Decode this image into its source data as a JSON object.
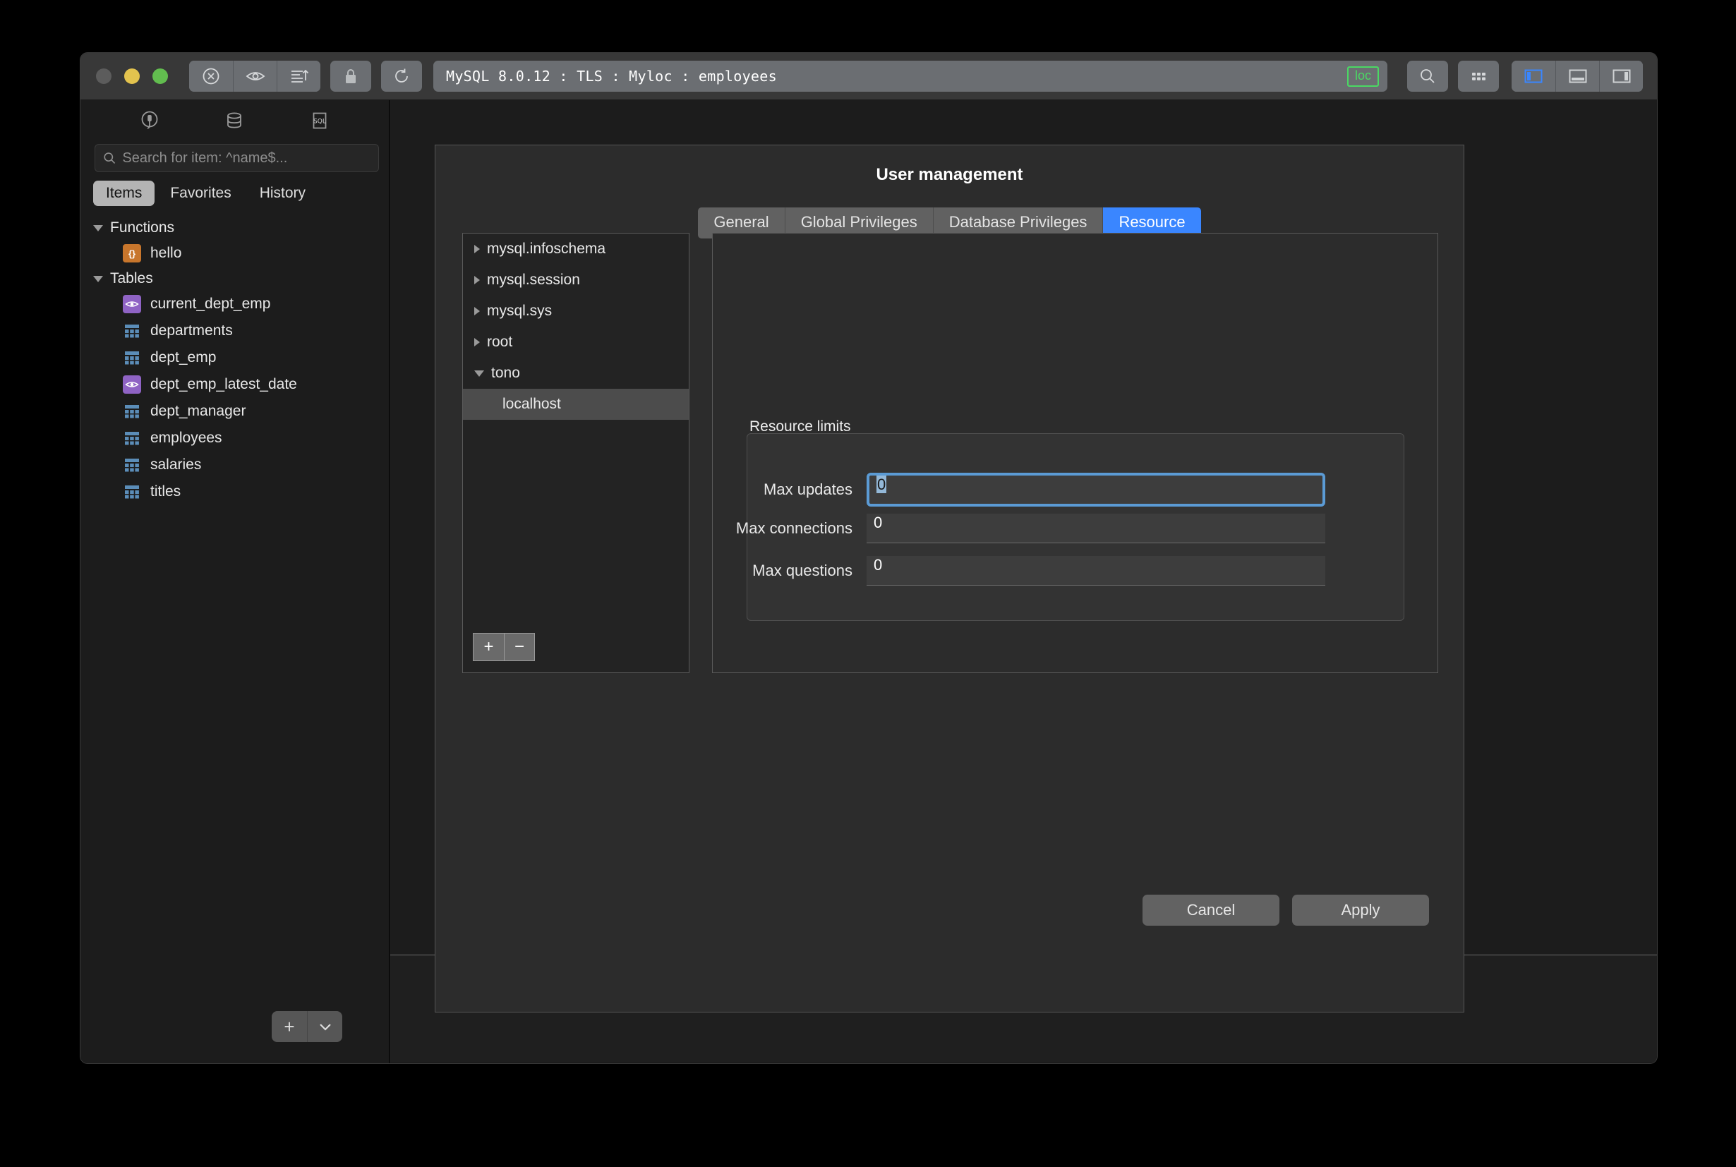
{
  "window": {
    "title": "MySQL 8.0.12 : TLS : Myloc : employees",
    "loc_badge": "loc",
    "accent_blue": "#3a86ff",
    "badge_green": "#4ad964"
  },
  "toolbar": {
    "stop_label": "stop-button",
    "preview_label": "preview-button",
    "export_label": "export-button",
    "lock_label": "lock-button",
    "refresh_label": "refresh-button",
    "search_label": "search-button",
    "grid_label": "grid-button",
    "panel_left_label": "left-panel-toggle",
    "panel_bottom_label": "bottom-panel-toggle",
    "panel_right_label": "right-panel-toggle"
  },
  "sidebar": {
    "icons": [
      "connection-icon",
      "database-icon",
      "sql-icon"
    ],
    "search": {
      "placeholder": "Search for item: ^name$...",
      "value": ""
    },
    "tabs": [
      {
        "label": "Items",
        "active": true
      },
      {
        "label": "Favorites",
        "active": false
      },
      {
        "label": "History",
        "active": false
      }
    ],
    "groups": [
      {
        "label": "Functions",
        "expanded": true,
        "items": [
          {
            "label": "hello",
            "icon": "function-icon"
          }
        ]
      },
      {
        "label": "Tables",
        "expanded": true,
        "items": [
          {
            "label": "current_dept_emp",
            "icon": "view-icon"
          },
          {
            "label": "departments",
            "icon": "table-icon"
          },
          {
            "label": "dept_emp",
            "icon": "table-icon"
          },
          {
            "label": "dept_emp_latest_date",
            "icon": "view-icon"
          },
          {
            "label": "dept_manager",
            "icon": "table-icon"
          },
          {
            "label": "employees",
            "icon": "table-icon"
          },
          {
            "label": "salaries",
            "icon": "table-icon"
          },
          {
            "label": "titles",
            "icon": "table-icon"
          }
        ]
      }
    ],
    "add_button": "+",
    "add_dropdown": "chevron-down-icon"
  },
  "dialog": {
    "title": "User management",
    "tabs": [
      {
        "label": "General",
        "active": false
      },
      {
        "label": "Global Privileges",
        "active": false
      },
      {
        "label": "Database Privileges",
        "active": false
      },
      {
        "label": "Resource",
        "active": true
      }
    ],
    "users": [
      {
        "label": "mysql.infoschema",
        "expanded": false,
        "child": false,
        "selected": false
      },
      {
        "label": "mysql.session",
        "expanded": false,
        "child": false,
        "selected": false
      },
      {
        "label": "mysql.sys",
        "expanded": false,
        "child": false,
        "selected": false
      },
      {
        "label": "root",
        "expanded": false,
        "child": false,
        "selected": false
      },
      {
        "label": "tono",
        "expanded": true,
        "child": false,
        "selected": false
      },
      {
        "label": "localhost",
        "expanded": null,
        "child": true,
        "selected": true
      }
    ],
    "list_add": "+",
    "list_remove": "−",
    "group_legend": "Resource limits",
    "fields": [
      {
        "label": "Max updates",
        "value": "0",
        "focused": true
      },
      {
        "label": "Max connections",
        "value": "0",
        "focused": false
      },
      {
        "label": "Max questions",
        "value": "0",
        "focused": false
      }
    ],
    "cancel_label": "Cancel",
    "apply_label": "Apply"
  }
}
